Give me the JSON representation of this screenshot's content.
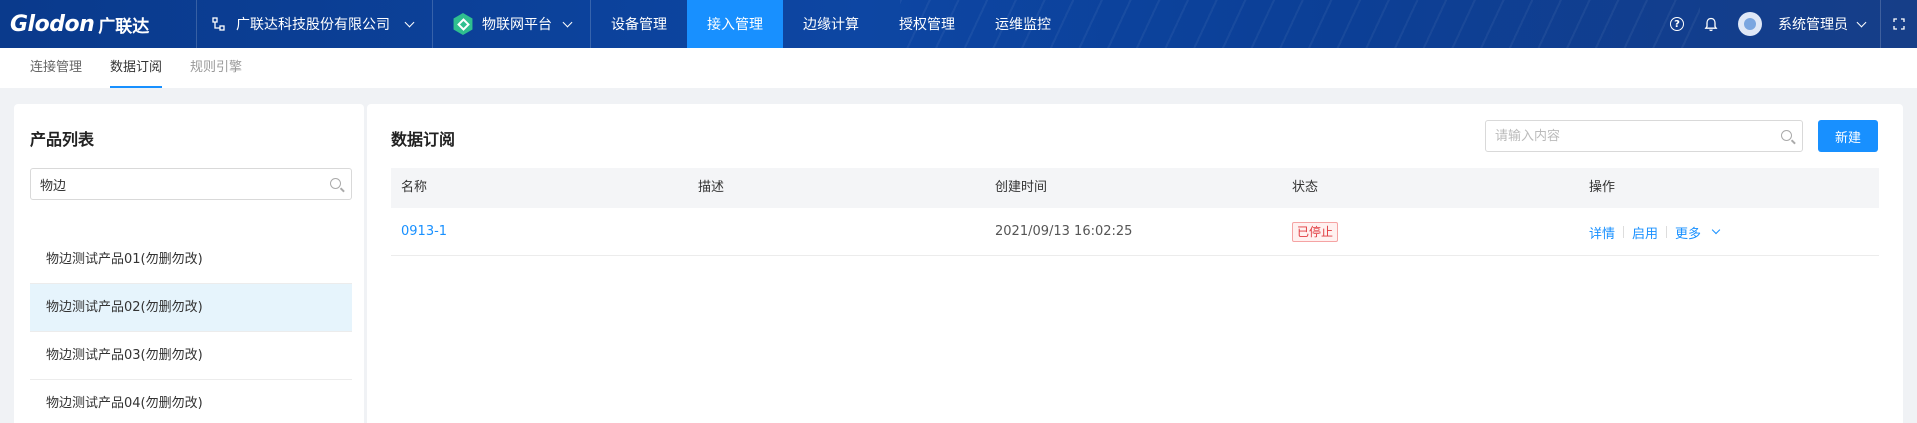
{
  "topbar": {
    "brand": "Glodon",
    "brand_cn": "广联达",
    "company": "广联达科技股份有限公司",
    "platform": "物联网平台",
    "nav": [
      "设备管理",
      "接入管理",
      "边缘计算",
      "授权管理",
      "运维监控"
    ],
    "active_nav": "接入管理",
    "user": "系统管理员",
    "colors": {
      "bar": "#0d46a3",
      "active": "#1890ff",
      "platform_icon": "#2fbf8f"
    }
  },
  "subtabs": [
    {
      "label": "连接管理"
    },
    {
      "label": "数据订阅"
    },
    {
      "label": "规则引擎"
    }
  ],
  "left_panel": {
    "title": "产品列表",
    "search_value": "物边",
    "products": [
      "物边测试产品01(勿删勿改)",
      "物边测试产品02(勿删勿改)",
      "物边测试产品03(勿删勿改)",
      "物边测试产品04(勿删勿改)"
    ],
    "selected_index": 1
  },
  "right_panel": {
    "title": "数据订阅",
    "search_placeholder": "请输入内容",
    "new_button": "新建",
    "columns": [
      "名称",
      "描述",
      "创建时间",
      "状态",
      "操作"
    ],
    "rows": [
      {
        "name": "0913-1",
        "description": "",
        "created": "2021/09/13 16:02:25",
        "status": "已停止",
        "actions": [
          "详情",
          "启用",
          "更多"
        ]
      }
    ]
  }
}
